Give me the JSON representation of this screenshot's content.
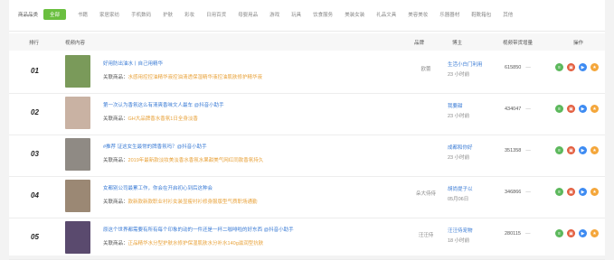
{
  "categories": {
    "label": "商品品类",
    "items": [
      "全部",
      "书籍",
      "家居家纺",
      "手机数码",
      "护肤",
      "彩妆",
      "日用百货",
      "母婴用品",
      "游戏",
      "玩具",
      "饮食服务",
      "美装女装",
      "礼品文具",
      "美容美妆",
      "乐器器材",
      "鞋靴箱包",
      "其他"
    ]
  },
  "table": {
    "headers": {
      "rank": "排行",
      "content": "视频内容",
      "brand": "品牌",
      "blogger": "博主",
      "sales": "视频带货增量",
      "ops": "操作"
    },
    "goods_prefix": "关联商品："
  },
  "rows": [
    {
      "rank": "01",
      "title": "好用防出油水丨自己用精华",
      "goods": "水感用控控油精华液控油清透保湿精华液控油肌肤修护精华液",
      "brand": "欧蕾",
      "blogger": "生活小白门利用",
      "time": "23 小时前",
      "sales": "615850",
      "trend": "—"
    },
    {
      "rank": "02",
      "title": "第一次认为香氛这么有清爽香味文人最车 @抖音小助手",
      "goods": "GH大品牌香水香氛1日全身淡香",
      "brand": "",
      "blogger": "我要甜",
      "time": "23 小时前",
      "sales": "434047",
      "trend": "—"
    },
    {
      "rank": "03",
      "title": "#推荐 证这女生最常的牌香氛吗？@抖音小助手",
      "goods": "2019年最新款淡妆美淡香水香氛水果甜美气网红同款香氛持久",
      "brand": "",
      "blogger": "成都和你好",
      "time": "23 小时前",
      "sales": "351358",
      "trend": "—"
    },
    {
      "rank": "04",
      "title": "女都别公司最累工作，你会在开启初心到后这种会",
      "goods": "款新款新款职业衬衫女装显瘦衬衫修身服版型气质职场通勤",
      "brand": "朵大侍侍",
      "blogger": "胡尚提子以",
      "time": "05月06日",
      "sales": "346866",
      "trend": "—"
    },
    {
      "rank": "05",
      "title": "原这个世界都需要有所有每个印象的动的一件还是一杯二咖啡啦的好东西 @抖音小助手",
      "goods": "正品精华水分型护肤水修护保湿肌肤水分补水140g滋润型抗肤",
      "brand": "汪汪侍",
      "blogger": "汪汪侍宠物",
      "time": "18 小时前",
      "sales": "280115",
      "trend": "—"
    }
  ],
  "op_icons": [
    "note-icon",
    "shop-icon",
    "play-icon",
    "star-icon"
  ],
  "thumb_colors": [
    "#7a9a5a",
    "#c9b2a3",
    "#8f8a84",
    "#9b8874",
    "#5a4a6e"
  ],
  "colors": {
    "accent": "#6abf3f",
    "link": "#3a7bd5",
    "goods": "#e8a23a"
  }
}
